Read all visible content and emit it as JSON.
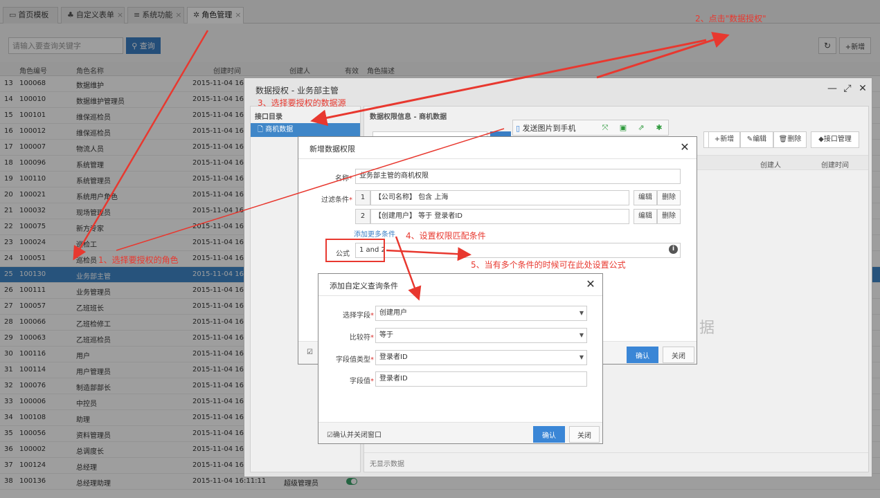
{
  "tabs": [
    {
      "label": "首页模板",
      "icon": "monitor-icon",
      "closable": false
    },
    {
      "label": "自定义表单",
      "icon": "sitemap-icon",
      "closable": true
    },
    {
      "label": "系统功能",
      "icon": "list-icon",
      "closable": true
    },
    {
      "label": "角色管理",
      "icon": "gear-icon",
      "closable": true
    }
  ],
  "toolbar": {
    "search_placeholder": "请输入要查询关键字",
    "search_label": "查询",
    "add_label": "新增"
  },
  "grid": {
    "columns": [
      "角色编号",
      "角色名称",
      "创建时间",
      "创建人",
      "有效",
      "角色描述"
    ],
    "rows": [
      {
        "idx": "13",
        "code": "100068",
        "name": "数据维护",
        "time": "2015-11-04 16:",
        "selected": false
      },
      {
        "idx": "14",
        "code": "100010",
        "name": "数据维护管理员",
        "time": "2015-11-04 16:",
        "selected": false
      },
      {
        "idx": "15",
        "code": "100101",
        "name": "维保巡检员",
        "time": "2015-11-04 16:",
        "selected": false
      },
      {
        "idx": "16",
        "code": "100012",
        "name": "维保巡检员",
        "time": "2015-11-04 16:",
        "selected": false
      },
      {
        "idx": "17",
        "code": "100007",
        "name": "物流人员",
        "time": "2015-11-04 16:",
        "selected": false
      },
      {
        "idx": "18",
        "code": "100096",
        "name": "系统管理",
        "time": "2015-11-04 16:",
        "selected": false
      },
      {
        "idx": "19",
        "code": "100110",
        "name": "系统管理员",
        "time": "2015-11-04 16:",
        "selected": false
      },
      {
        "idx": "20",
        "code": "100021",
        "name": "系统用户角色",
        "time": "2015-11-04 16:",
        "selected": false
      },
      {
        "idx": "21",
        "code": "100032",
        "name": "现场管理员",
        "time": "2015-11-04 16:",
        "selected": false
      },
      {
        "idx": "22",
        "code": "100075",
        "name": "新方专家",
        "time": "2015-11-04 16:",
        "selected": false
      },
      {
        "idx": "23",
        "code": "100024",
        "name": "巡检工",
        "time": "2015-11-04 16:",
        "selected": false
      },
      {
        "idx": "24",
        "code": "100051",
        "name": "巡检员",
        "time": "2015-11-04 16:",
        "selected": false
      },
      {
        "idx": "25",
        "code": "100130",
        "name": "业务部主管",
        "time": "2015-11-04 16:",
        "selected": true
      },
      {
        "idx": "26",
        "code": "100111",
        "name": "业务管理员",
        "time": "2015-11-04 16:",
        "selected": false
      },
      {
        "idx": "27",
        "code": "100057",
        "name": "乙班班长",
        "time": "2015-11-04 16:",
        "selected": false
      },
      {
        "idx": "28",
        "code": "100066",
        "name": "乙班检修工",
        "time": "2015-11-04 16:",
        "selected": false
      },
      {
        "idx": "29",
        "code": "100063",
        "name": "乙班巡检员",
        "time": "2015-11-04 16:",
        "selected": false
      },
      {
        "idx": "30",
        "code": "100116",
        "name": "用户",
        "time": "2015-11-04 16:",
        "selected": false
      },
      {
        "idx": "31",
        "code": "100114",
        "name": "用户管理员",
        "time": "2015-11-04 16:",
        "selected": false
      },
      {
        "idx": "32",
        "code": "100076",
        "name": "制造部部长",
        "time": "2015-11-04 16:",
        "selected": false
      },
      {
        "idx": "33",
        "code": "100006",
        "name": "中控员",
        "time": "2015-11-04 16:",
        "selected": false
      },
      {
        "idx": "34",
        "code": "100108",
        "name": "助理",
        "time": "2015-11-04 16:",
        "selected": false
      },
      {
        "idx": "35",
        "code": "100056",
        "name": "资料管理员",
        "time": "2015-11-04 16:",
        "selected": false
      },
      {
        "idx": "36",
        "code": "100002",
        "name": "总调度长",
        "time": "2015-11-04 16:",
        "selected": false
      },
      {
        "idx": "37",
        "code": "100124",
        "name": "总经理",
        "time": "2015-11-04 16:",
        "selected": false
      },
      {
        "idx": "38",
        "code": "100136",
        "name": "总经理助理",
        "time": "2015-11-04 16:11:11",
        "creator": "超级管理员",
        "selected": false
      }
    ]
  },
  "auth_dialog": {
    "title": "数据授权 - 业务部主管",
    "left_title": "接口目录",
    "tree_item": "商机数据",
    "right_title": "数据权限信息 - 商机数据",
    "buttons": [
      "新增",
      "编辑",
      "删除",
      "接口管理"
    ],
    "columns": [
      "创建人",
      "创建时间"
    ],
    "watermark": "据",
    "empty_text": "无显示数据"
  },
  "permission_dialog": {
    "title": "新增数据权限",
    "name_label": "名称",
    "name_value": "业务部主管的商机权限",
    "filter_label": "过滤条件",
    "conditions": [
      {
        "no": "1",
        "text": "【公司名称】 包含 上海"
      },
      {
        "no": "2",
        "text": "【创建用户】 等于 登录者ID"
      }
    ],
    "edit_label": "编辑",
    "delete_label": "删除",
    "add_more_label": "添加更多条件",
    "formula_label": "公式",
    "formula_value": "1 and 2",
    "ok_label": "确认",
    "close_label": "关闭"
  },
  "condition_dialog": {
    "title": "添加自定义查询条件",
    "fields": [
      {
        "label": "选择字段",
        "value": "创建用户",
        "select": true
      },
      {
        "label": "比较符",
        "value": "等于",
        "select": true
      },
      {
        "label": "字段值类型",
        "value": "登录者ID",
        "select": true
      },
      {
        "label": "字段值",
        "value": "登录者ID",
        "select": false
      }
    ],
    "confirm_close_label": "确认并关闭窗口",
    "ok_label": "确认",
    "close_label": "关闭"
  },
  "float_toolbar": {
    "send_label": "发送图片到手机"
  },
  "annotations": {
    "step1": "1、选择要授权的角色",
    "step2": "2、点击\"数据授权\"",
    "step3": "3、选择要授权的数据源",
    "step4": "4、设置权限匹配条件",
    "step5": "5、当有多个条件的时候可在此处设置公式",
    "color": "#e8382f"
  },
  "colors": {
    "primary": "#3a7ec4",
    "selected_row": "#3f86c8",
    "toggle_on": "#3aa26a"
  }
}
